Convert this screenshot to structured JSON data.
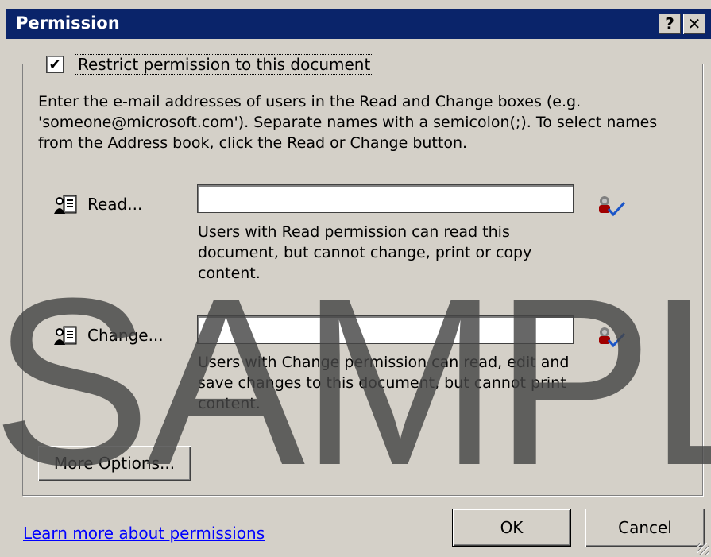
{
  "window": {
    "title": "Permission",
    "help_button": "?",
    "close_button": "✕"
  },
  "restrict": {
    "checked": true,
    "check_mark": "✔",
    "label": "Restrict permission to this document"
  },
  "instructions": "Enter the e-mail addresses of users in the Read and Change boxes (e.g. 'someone@microsoft.com'). Separate names with a semicolon(;). To select names from the Address book, click the Read or Change button.",
  "read": {
    "button_label": "Read...",
    "value": "",
    "description": "Users with Read permission can read this document, but cannot change, print or copy content."
  },
  "change": {
    "button_label": "Change...",
    "value": "",
    "description": "Users with Change permission can read, edit and save changes to this document, but cannot print content."
  },
  "buttons": {
    "more_options": "More Options...",
    "ok": "OK",
    "cancel": "Cancel"
  },
  "link": {
    "learn_more": "Learn more about permissions"
  },
  "watermark": "SAMPLE",
  "colors": {
    "titlebar": "#0a246a",
    "face": "#d4d0c8",
    "link": "#0000ff"
  },
  "icons": [
    "address-book-icon",
    "check-names-icon",
    "checkbox-check-icon"
  ]
}
